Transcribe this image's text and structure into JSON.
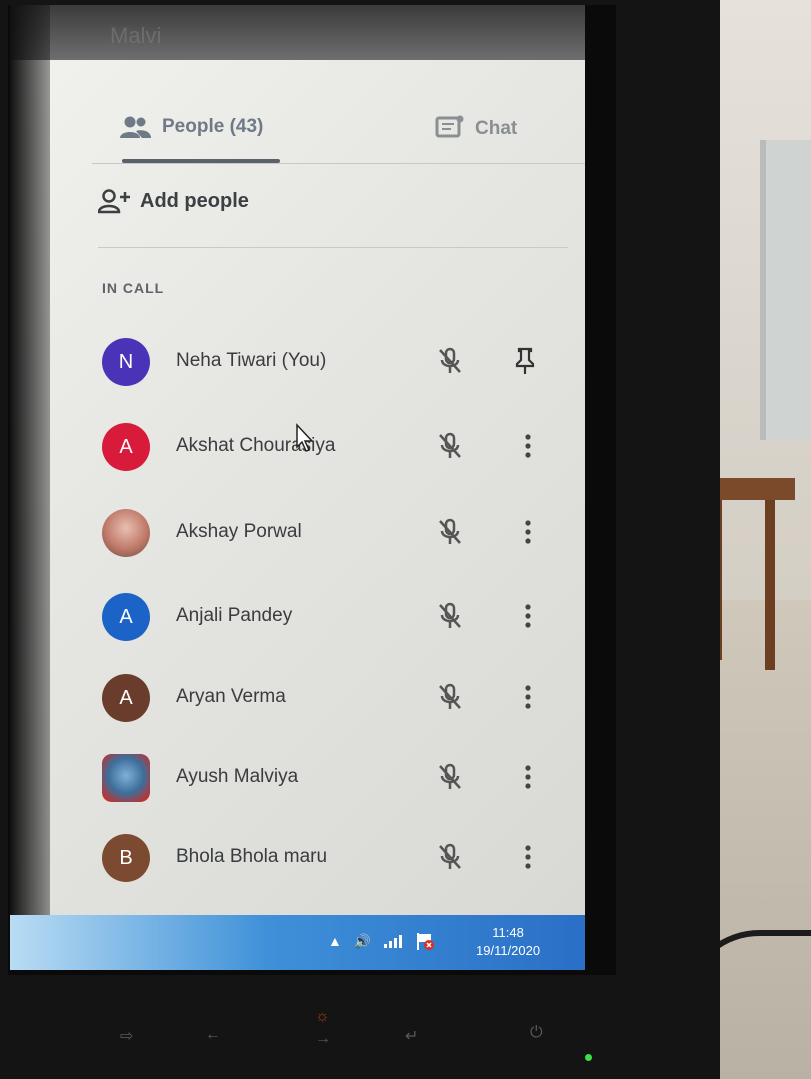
{
  "window": {
    "title": "Malvi"
  },
  "tabs": {
    "people_label": "People (43)",
    "chat_label": "Chat",
    "active": "people"
  },
  "add_people_label": "Add people",
  "section_label": "IN CALL",
  "participants": [
    {
      "name": "Neha Tiwari (You)",
      "initial": "N",
      "color": "#4b33b8",
      "avatar": "letter",
      "action": "pin-icon"
    },
    {
      "name": "Akshat Chourasiya",
      "initial": "A",
      "color": "#d81a3b",
      "avatar": "letter",
      "action": "more-icon"
    },
    {
      "name": "Akshay Porwal",
      "initial": "",
      "color": "#c07a6a",
      "avatar": "photo",
      "action": "more-icon"
    },
    {
      "name": "Anjali Pandey",
      "initial": "A",
      "color": "#1b63c6",
      "avatar": "letter",
      "action": "more-icon"
    },
    {
      "name": "Aryan Verma",
      "initial": "A",
      "color": "#6a3c2b",
      "avatar": "letter",
      "action": "more-icon"
    },
    {
      "name": "Ayush Malviya",
      "initial": "",
      "color": "#3d6e9a",
      "avatar": "image",
      "action": "more-icon"
    },
    {
      "name": "Bhola Bhola maru",
      "initial": "B",
      "color": "#7b4a30",
      "avatar": "letter",
      "action": "more-icon"
    }
  ],
  "taskbar": {
    "time": "11:48",
    "date": "19/11/2020",
    "tray_icons": [
      "arrow-up-icon",
      "volume-icon",
      "network-icon",
      "flag-icon"
    ]
  },
  "colors": {
    "tab_active": "#5a6168",
    "text": "#3a3d40",
    "taskbar": "#2a6fc7",
    "power_led": "#3be04a"
  }
}
